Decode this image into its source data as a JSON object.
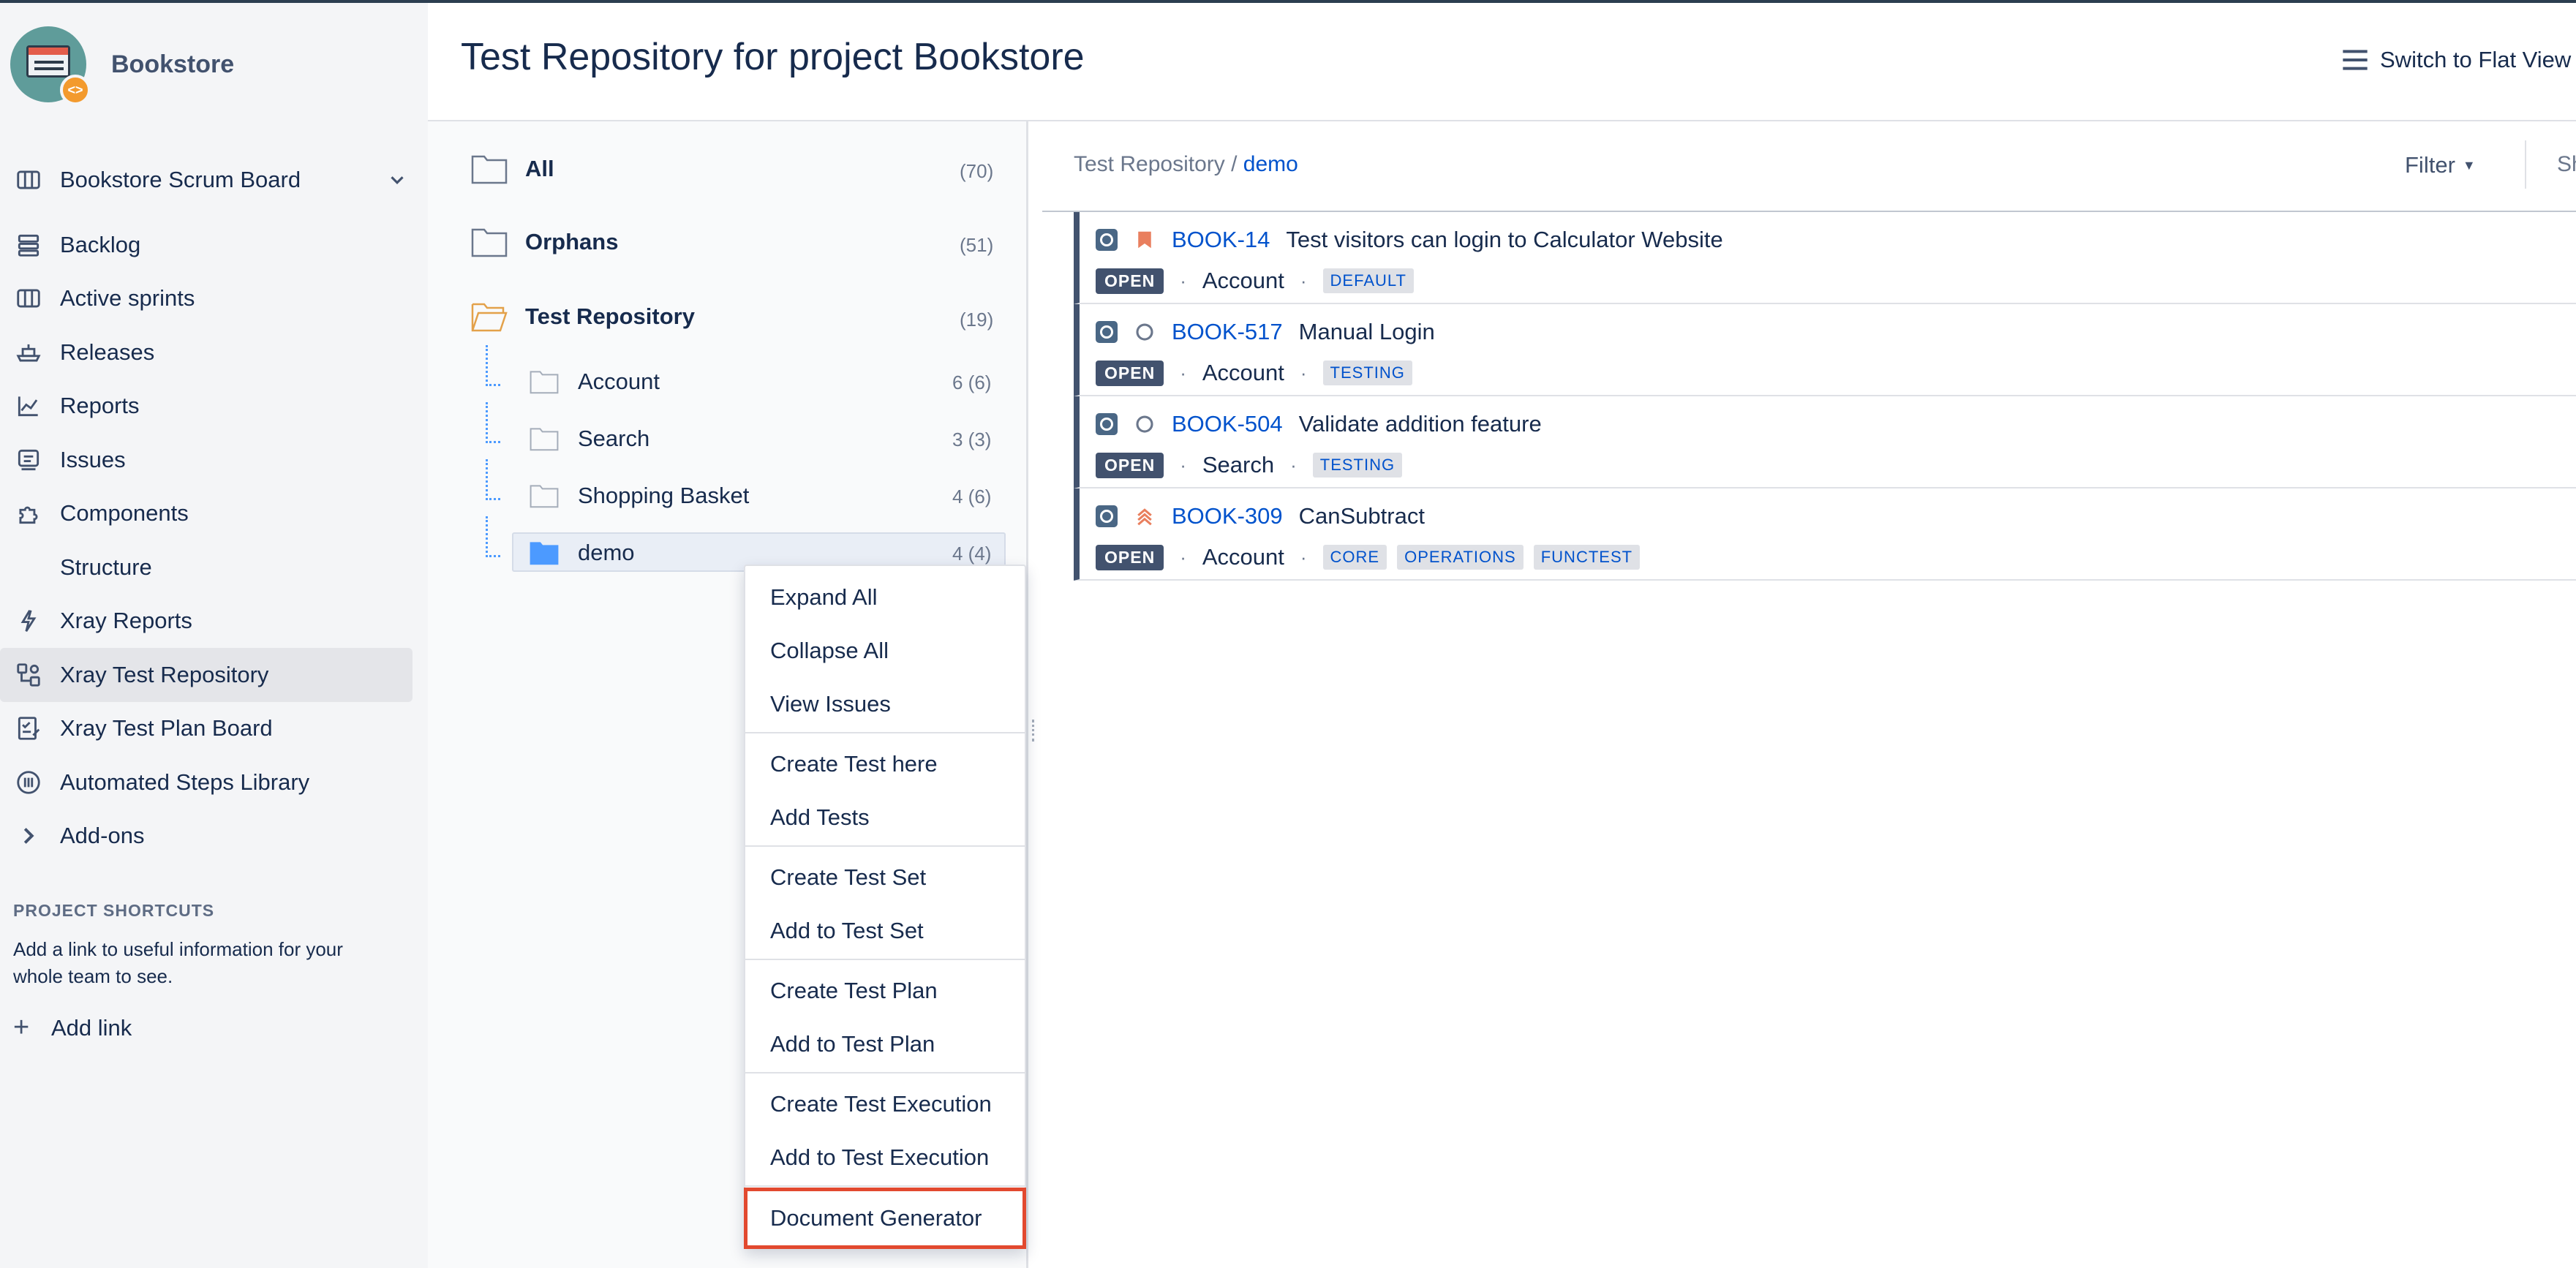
{
  "project": {
    "name": "Bookstore",
    "board": "Bookstore Scrum Board"
  },
  "sidebar": {
    "items": [
      {
        "label": "Backlog",
        "icon": "backlog-icon"
      },
      {
        "label": "Active sprints",
        "icon": "board-icon"
      },
      {
        "label": "Releases",
        "icon": "ship-icon"
      },
      {
        "label": "Reports",
        "icon": "chart-icon"
      },
      {
        "label": "Issues",
        "icon": "issues-icon"
      },
      {
        "label": "Components",
        "icon": "puzzle-icon"
      },
      {
        "label": "Structure",
        "icon": ""
      },
      {
        "label": "Xray Reports",
        "icon": "bolt-icon"
      },
      {
        "label": "Xray Test Repository",
        "icon": "repository-icon",
        "active": true
      },
      {
        "label": "Xray Test Plan Board",
        "icon": "plan-board-icon"
      },
      {
        "label": "Automated Steps Library",
        "icon": "library-icon"
      },
      {
        "label": "Add-ons",
        "icon": "chevron-right-icon"
      }
    ],
    "shortcuts_title": "PROJECT SHORTCUTS",
    "shortcuts_desc": "Add a link to useful information for your whole team to see.",
    "add_link": "Add link"
  },
  "header": {
    "title": "Test Repository for project Bookstore",
    "flat_view": "Switch to Flat View"
  },
  "tree": {
    "root": [
      {
        "label": "All",
        "count": "(70)"
      },
      {
        "label": "Orphans",
        "count": "(51)"
      },
      {
        "label": "Test Repository",
        "count": "(19)"
      }
    ],
    "children": [
      {
        "label": "Account",
        "count": "6 (6)"
      },
      {
        "label": "Search",
        "count": "3 (3)"
      },
      {
        "label": "Shopping Basket",
        "count": "4 (6)"
      },
      {
        "label": "demo",
        "count": "4 (4)"
      }
    ]
  },
  "context_menu": {
    "items": [
      "Expand All",
      "Collapse All",
      "View Issues",
      "Create Test here",
      "Add Tests",
      "Create Test Set",
      "Add to Test Set",
      "Create Test Plan",
      "Add to Test Plan",
      "Create Test Execution",
      "Add to Test Execution",
      "Document Generator"
    ],
    "highlighted": "Document Generator"
  },
  "panel": {
    "breadcrumb_root": "Test Repository",
    "breadcrumb_sep": " / ",
    "breadcrumb_current": "demo",
    "filter": "Filter",
    "cut_text": "Sh"
  },
  "issues": [
    {
      "key": "BOOK-14",
      "summary": "Test visitors can login to Calculator Website",
      "status": "OPEN",
      "component": "Account",
      "labels": [
        "DEFAULT"
      ],
      "priority": "bookmark-priority-icon"
    },
    {
      "key": "BOOK-517",
      "summary": "Manual Login",
      "status": "OPEN",
      "component": "Account",
      "labels": [
        "TESTING"
      ],
      "priority": "circle-priority-icon"
    },
    {
      "key": "BOOK-504",
      "summary": "Validate addition feature",
      "status": "OPEN",
      "component": "Search",
      "labels": [
        "TESTING"
      ],
      "priority": "circle-priority-icon"
    },
    {
      "key": "BOOK-309",
      "summary": "CanSubtract",
      "status": "OPEN",
      "component": "Account",
      "labels": [
        "CORE",
        "OPERATIONS",
        "FUNCTEST"
      ],
      "priority": "highest-priority-icon"
    }
  ],
  "colors": {
    "accent": "#0052cc",
    "highlight_border": "#e2492f",
    "status_badge": "#42526e"
  }
}
